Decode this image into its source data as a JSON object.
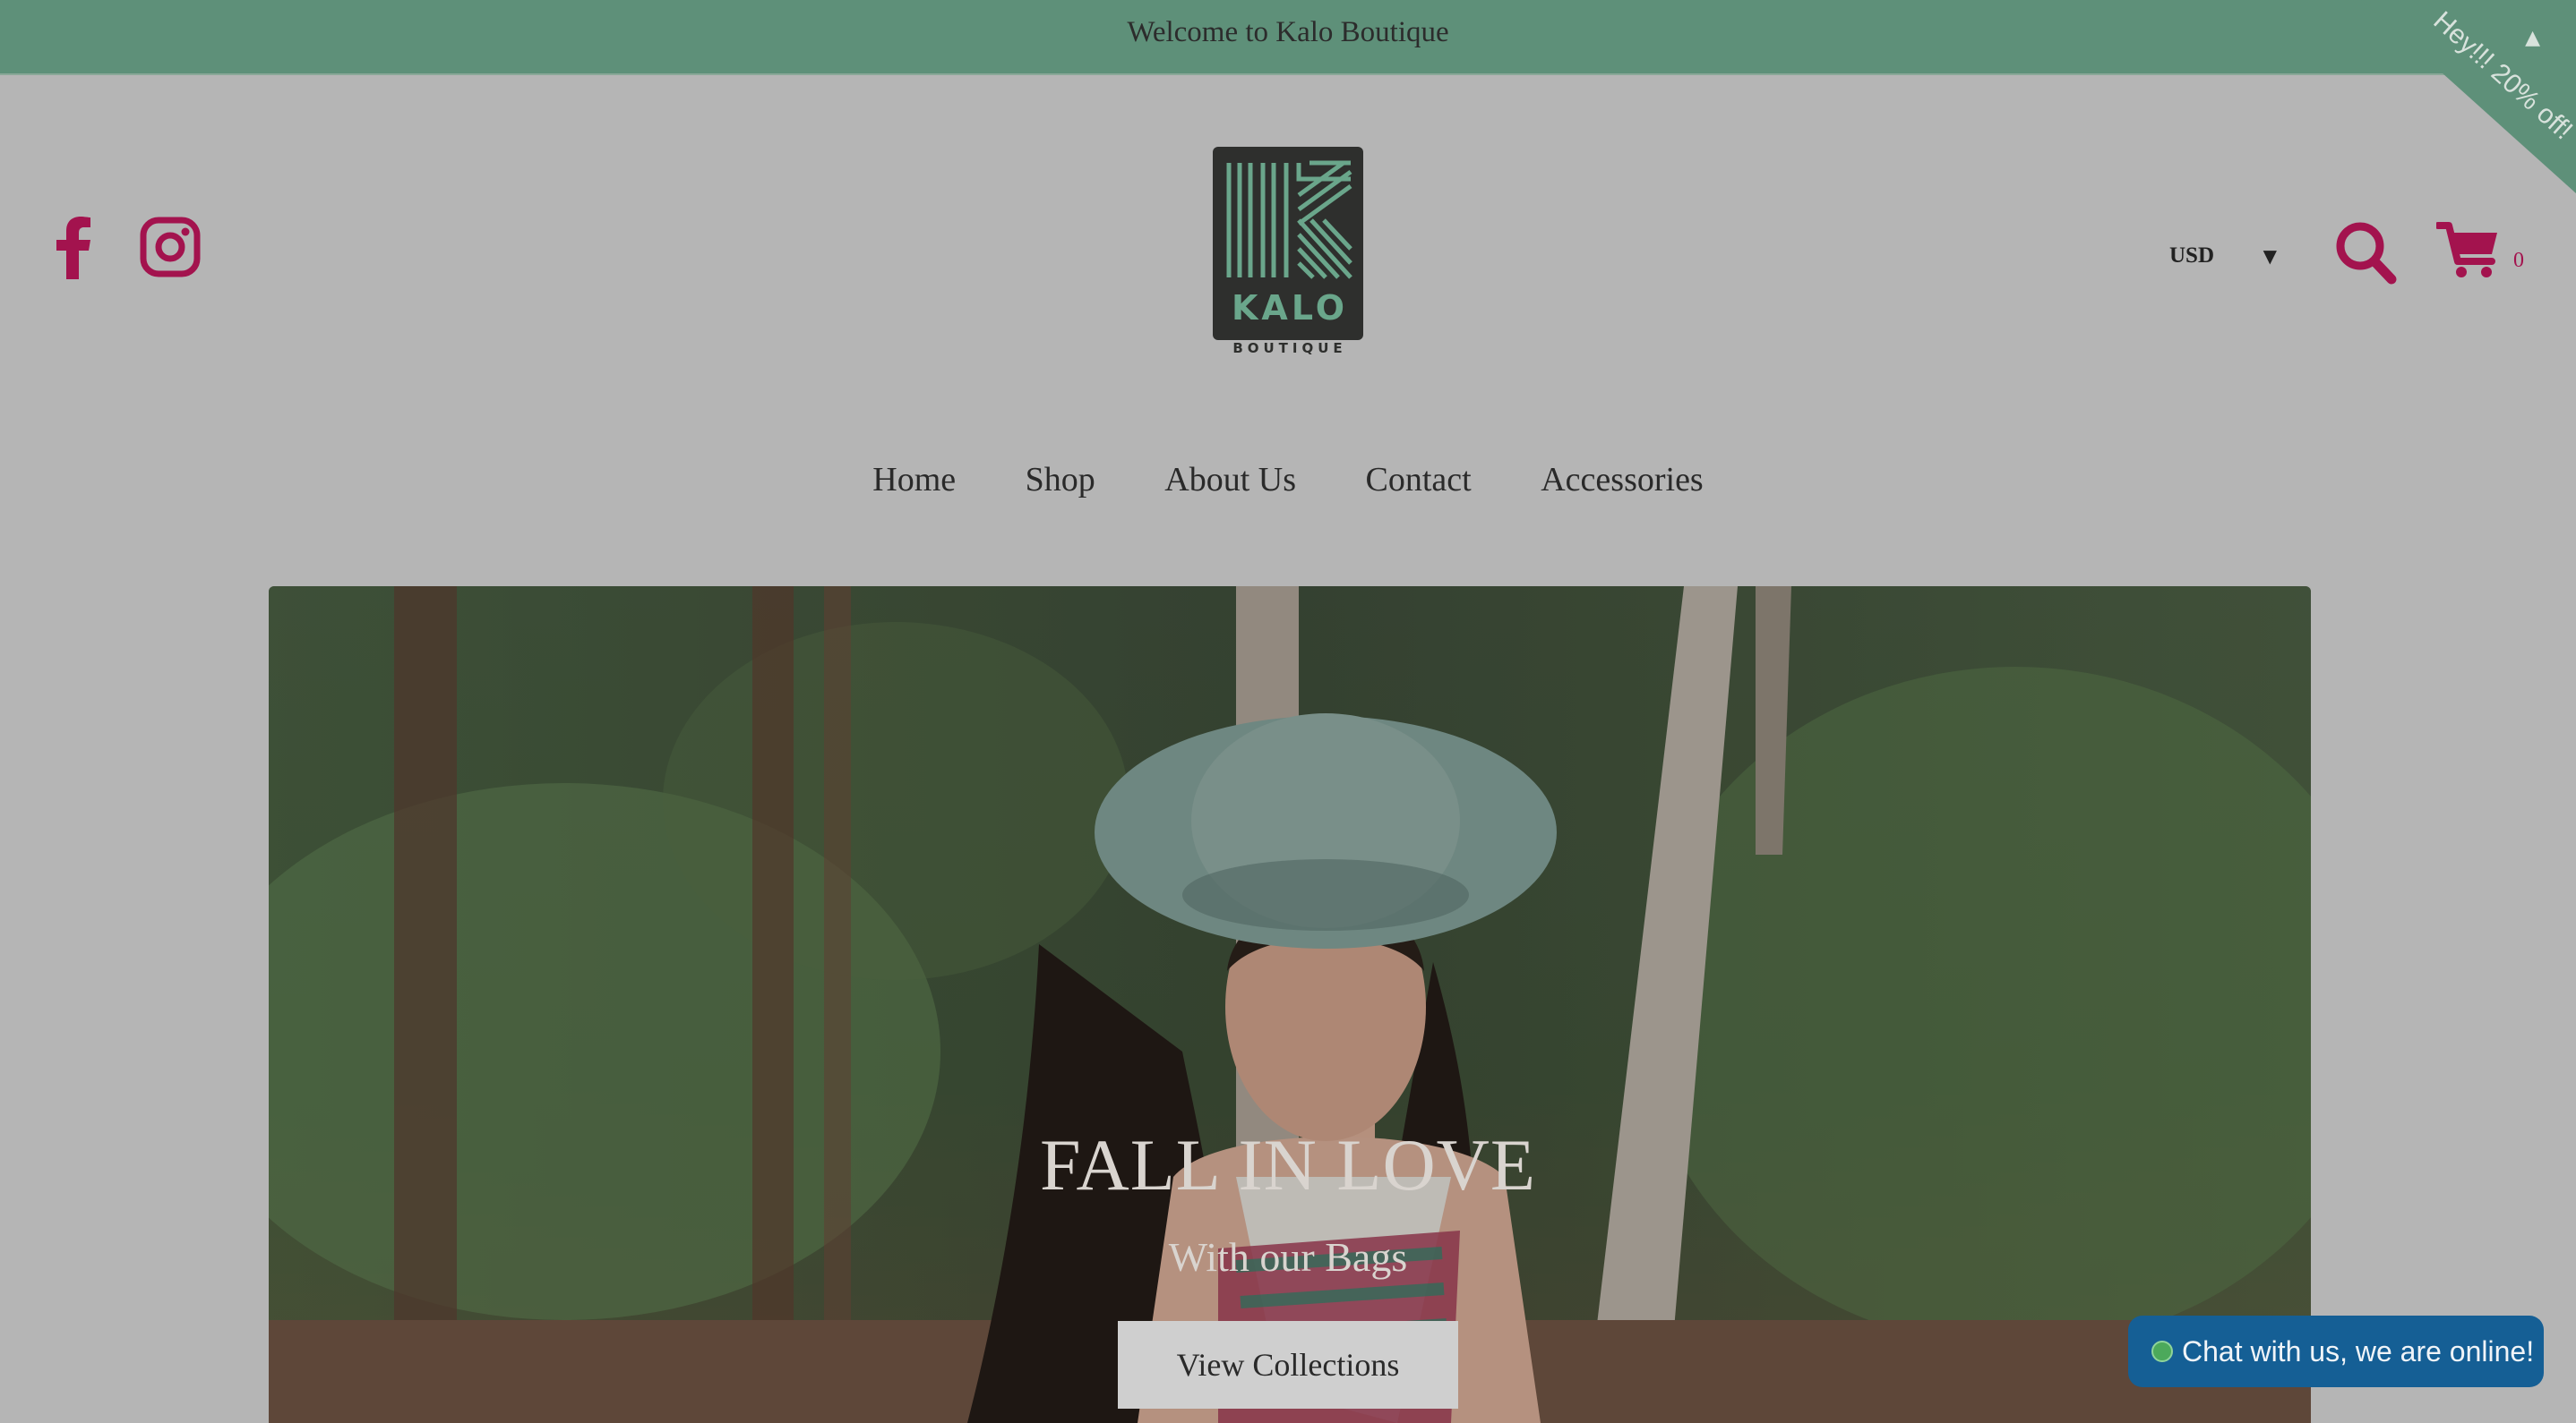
{
  "announcement": {
    "text": "Welcome to Kalo Boutique"
  },
  "promo_ribbon": {
    "text": "Hey!!! 20% off!"
  },
  "social": [
    {
      "icon": "facebook-icon"
    },
    {
      "icon": "instagram-icon"
    }
  ],
  "logo": {
    "name": "KALO",
    "tagline": "BOUTIQUE"
  },
  "header": {
    "currency": "USD",
    "cart_count": "0",
    "icons": {
      "search": "search-icon",
      "cart": "cart-icon"
    },
    "accent_color": "#a3134e"
  },
  "nav": {
    "items": [
      "Home",
      "Shop",
      "About Us",
      "Contact",
      "Accessories"
    ]
  },
  "hero": {
    "title": "FALL IN LOVE",
    "subtitle": "With our Bags",
    "button_label": "View Collections"
  },
  "chat": {
    "label": "Chat with us, we are online!"
  },
  "colors": {
    "topbar": "#5e9079",
    "chat": "#155f95",
    "page_bg": "#b5b5b5"
  }
}
